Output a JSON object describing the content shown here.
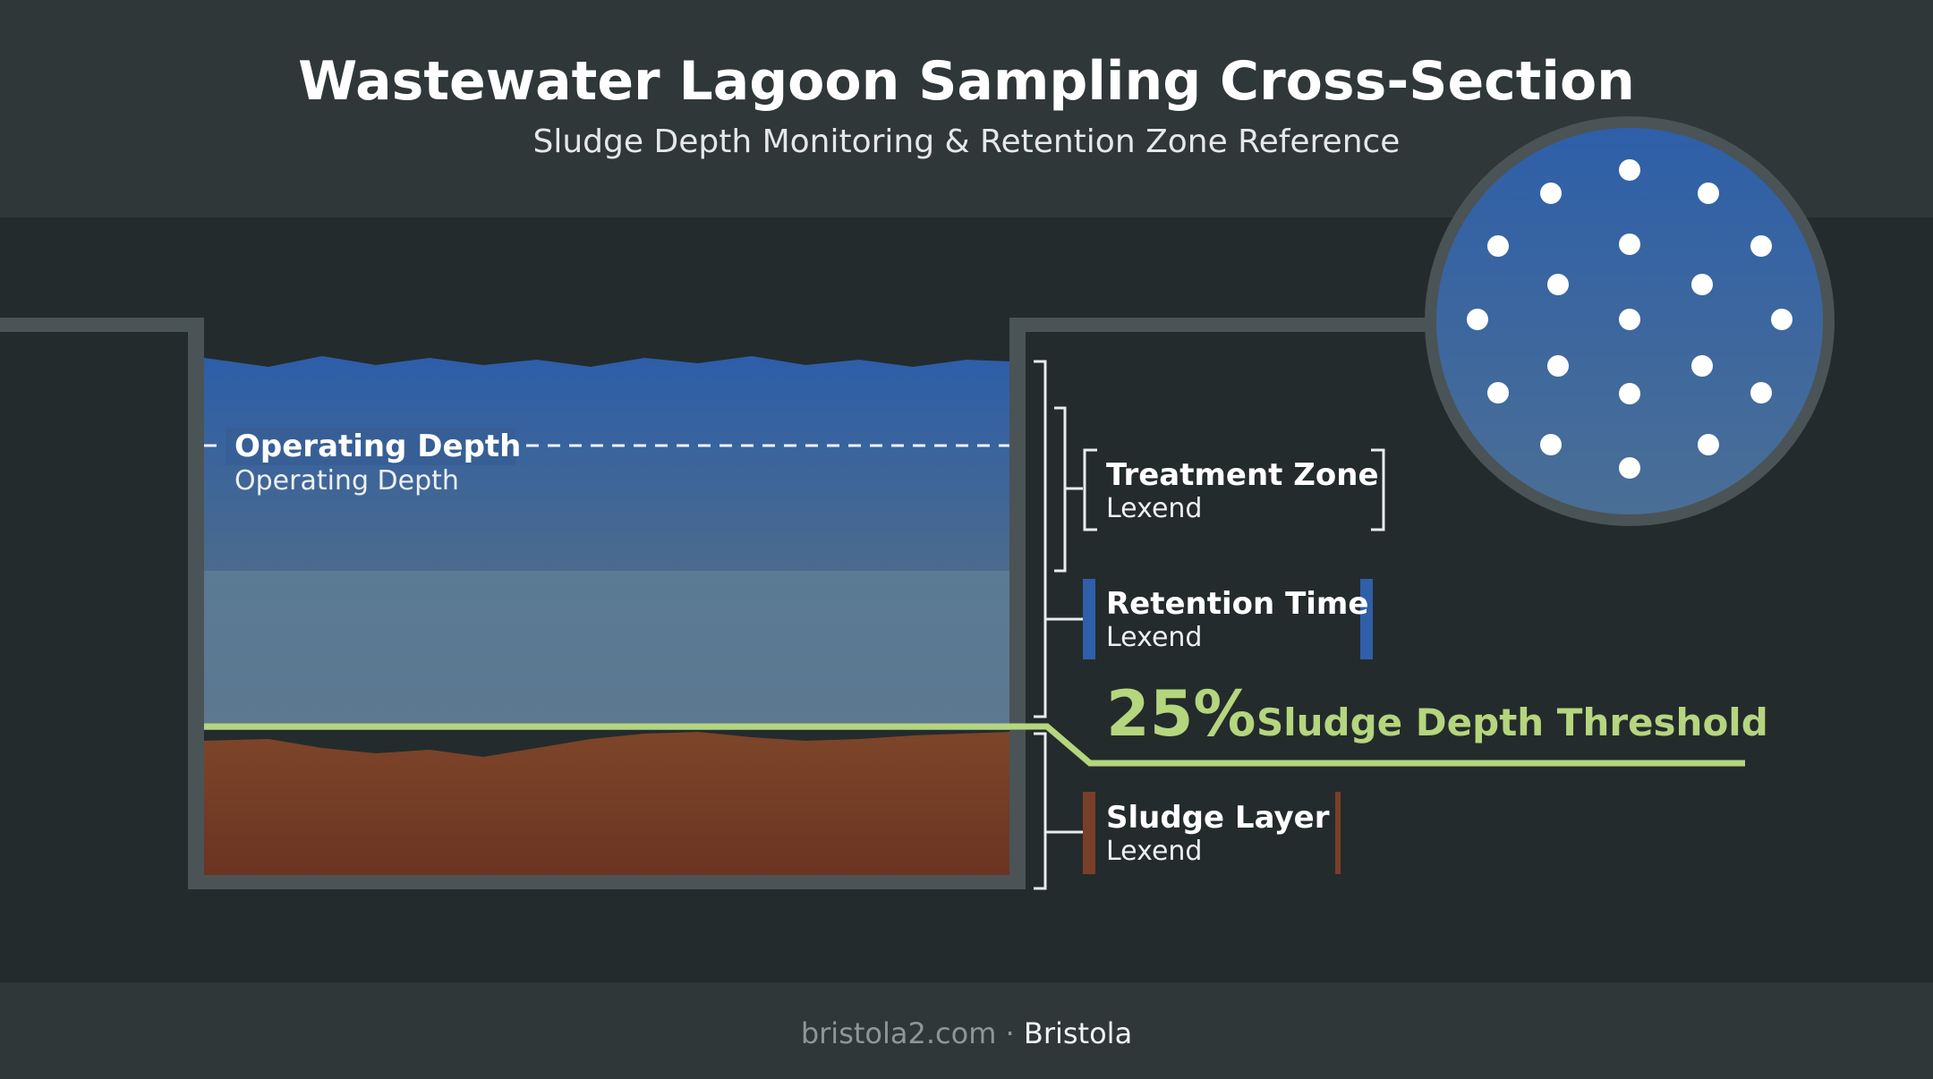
{
  "header": {
    "title": "Wastewater Lagoon Sampling Cross-Section",
    "subtitle": "Sludge Depth Monitoring & Retention Zone Reference"
  },
  "lagoon": {
    "operating_depth_label": "Operating Depth",
    "operating_depth_sublabel": "Operating Depth"
  },
  "zones": [
    {
      "title": "Treatment Zone",
      "subtitle": "Lexend"
    },
    {
      "title": "Retention Time",
      "subtitle": "Lexend"
    },
    {
      "title": "Sludge Layer",
      "subtitle": "Lexend"
    }
  ],
  "threshold": {
    "value": "25%",
    "label": "Sludge Depth Threshold"
  },
  "footer": {
    "site": "bristola2.com",
    "separator": " · ",
    "brand": "Bristola"
  },
  "colors": {
    "background": "#262d2e",
    "header_band": "#2e3638",
    "water_top": "#2f5fa8",
    "water_mid": "#4a6e95",
    "retention_band": "#5b7b96",
    "sludge": "#7a3f28",
    "threshold": "#b5d57e",
    "retention_bar": "#2f5fa8",
    "sludge_bar": "#7a3f28",
    "wall": "#4a5356",
    "dots": "#ffffff"
  }
}
